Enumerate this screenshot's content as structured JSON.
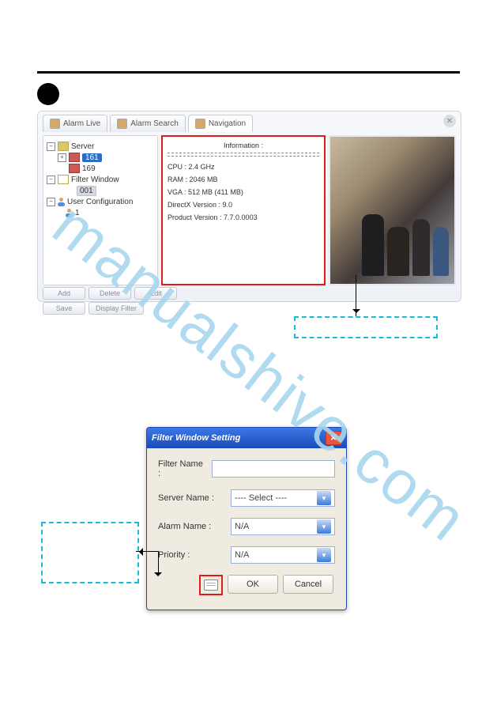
{
  "tabs": {
    "alarm_live": "Alarm Live",
    "alarm_search": "Alarm Search",
    "navigation": "Navigation"
  },
  "tree": {
    "server": "Server",
    "ip1": "161",
    "ip2": "169",
    "filter_window": "Filter Window",
    "filter_child": "001",
    "user_config": "User Configuration",
    "user_child": "1"
  },
  "toolbar": {
    "add": "Add",
    "delete": "Delete",
    "edit": "Edit",
    "save": "Save",
    "display_filter": "Display Filter"
  },
  "info": {
    "title": "Information :",
    "cpu": "CPU : 2.4 GHz",
    "ram": "RAM : 2046 MB",
    "vga": "VGA : 512 MB (411 MB)",
    "dx": "DirectX Version : 9.0",
    "product": "Product Version : 7.7.0.0003"
  },
  "dialog": {
    "title": "Filter Window Setting",
    "filter_name_label": "Filter Name :",
    "server_name_label": "Server Name :",
    "alarm_name_label": "Alarm Name :",
    "priority_label": "Priority :",
    "server_name_value": "----  Select  ----",
    "alarm_name_value": "N/A",
    "priority_value": "N/A",
    "ok": "OK",
    "cancel": "Cancel"
  },
  "watermark": "manualshive.com"
}
